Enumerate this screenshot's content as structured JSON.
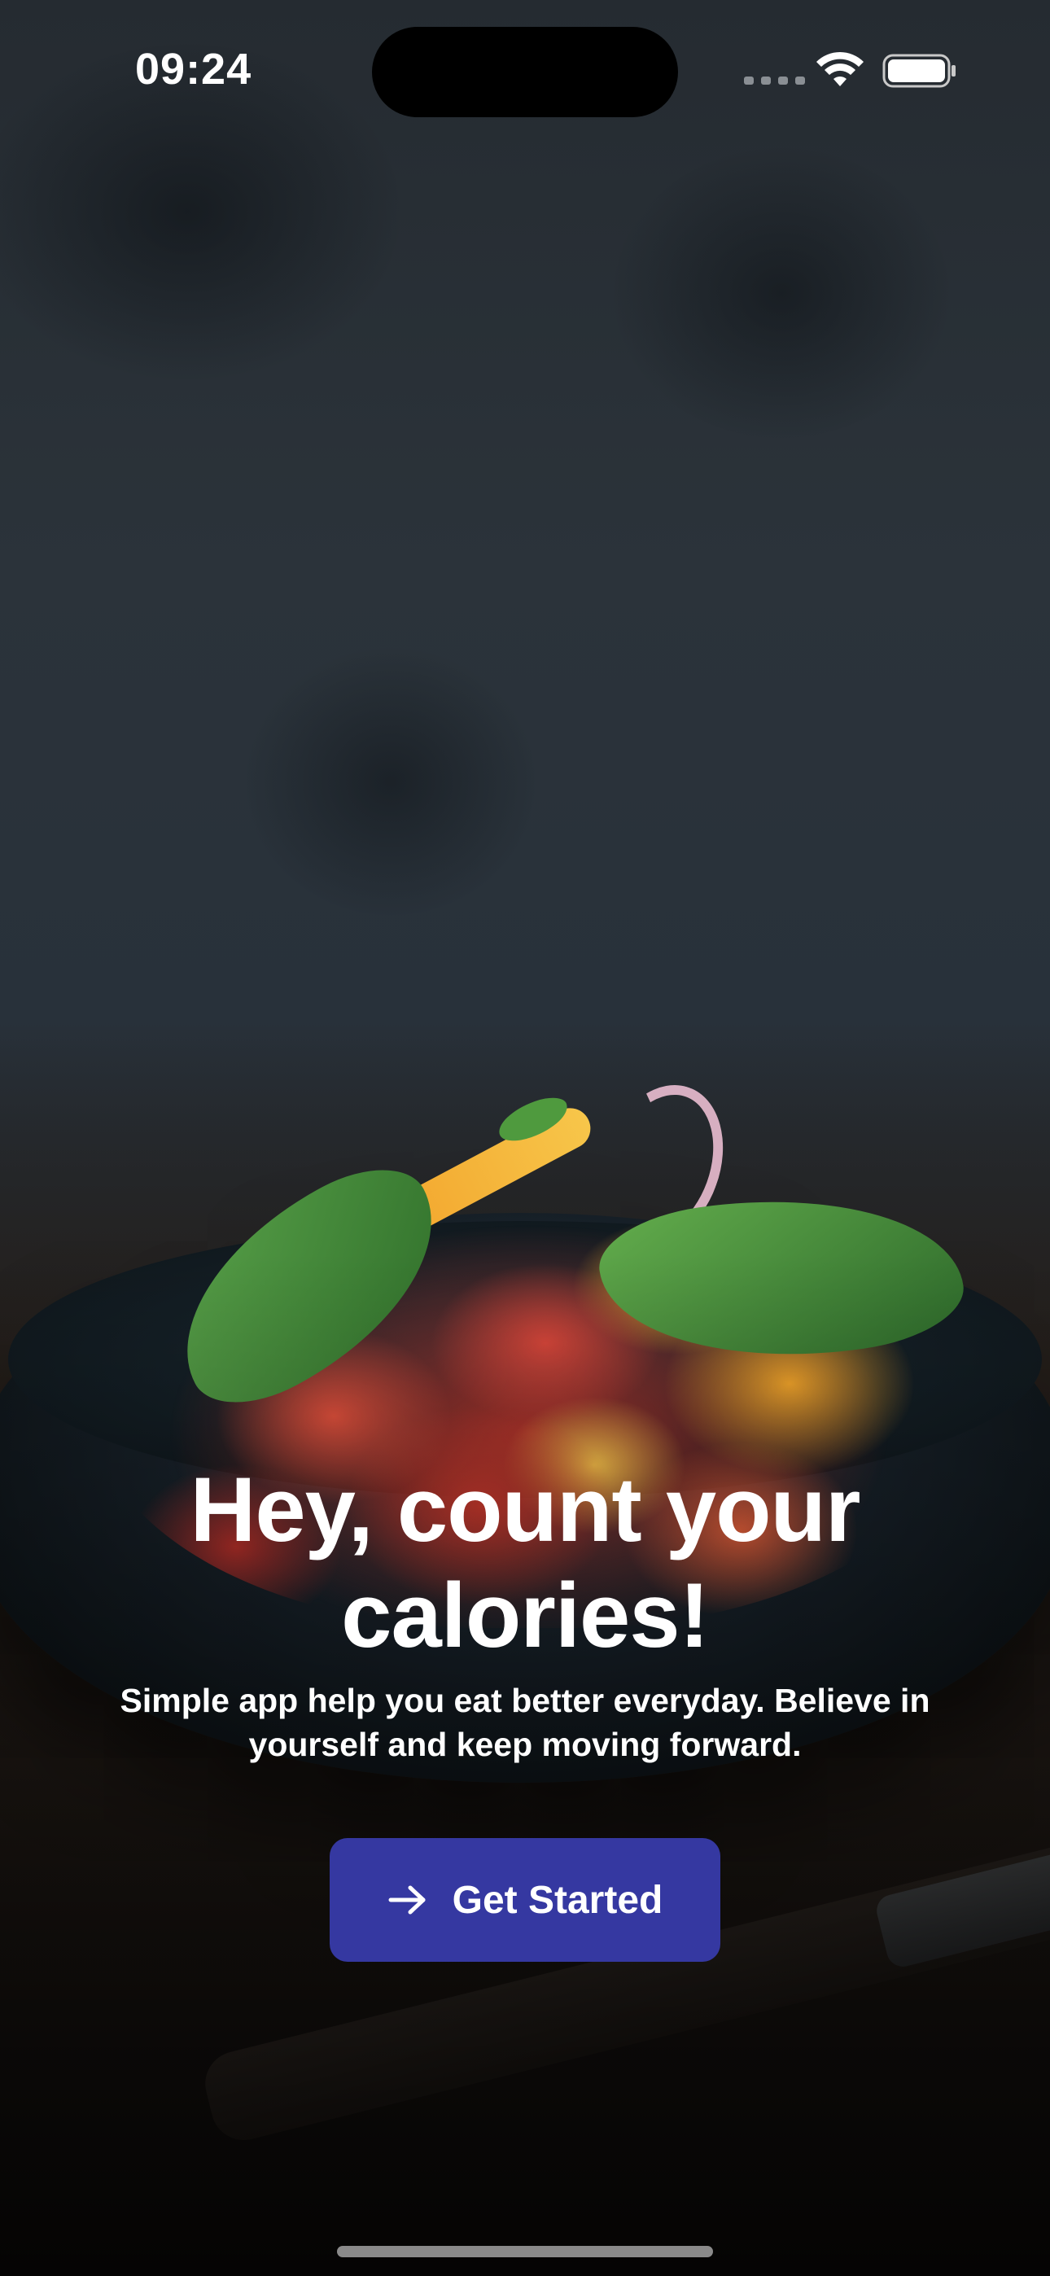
{
  "status_bar": {
    "time": "09:24",
    "icons": [
      "signal-icon",
      "wifi-icon",
      "battery-icon"
    ]
  },
  "hero": {
    "image": "salad-bowl-photo"
  },
  "onboarding": {
    "headline": "Hey, count your calories!",
    "subtitle": "Simple app help you eat better everyday. Believe in yourself and keep moving forward.",
    "cta_label": "Get Started",
    "cta_icon": "arrow-right-icon",
    "cta_color": "#3538A1"
  }
}
